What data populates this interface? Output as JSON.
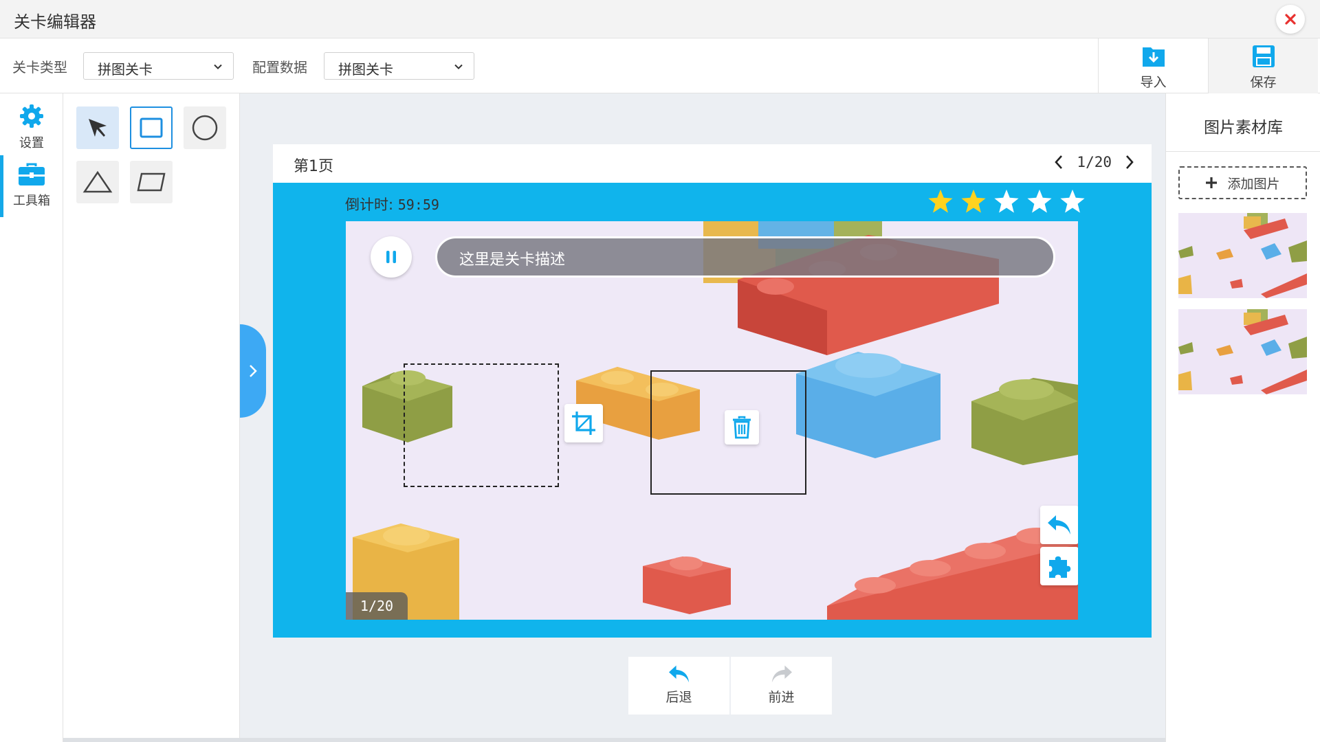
{
  "window": {
    "title": "关卡编辑器",
    "close_icon": "close-icon"
  },
  "toolbar": {
    "level_type_label": "关卡类型",
    "level_type_value": "拼图关卡",
    "config_label": "配置数据",
    "config_value": "拼图关卡",
    "import_label": "导入",
    "save_label": "保存"
  },
  "leftnav": {
    "settings_label": "设置",
    "toolbox_label": "工具箱"
  },
  "tools": [
    "select",
    "rectangle",
    "ellipse",
    "triangle",
    "parallelogram"
  ],
  "page": {
    "title": "第1页",
    "pager": "1/20",
    "countdown_label": "倒计时:",
    "countdown_value": "59:59",
    "stars_filled": 2,
    "stars_total": 5,
    "description": "这里是关卡描述",
    "counter": "1/20"
  },
  "history": {
    "undo_label": "后退",
    "redo_label": "前进"
  },
  "library": {
    "title": "图片素材库",
    "add_label": "添加图片",
    "thumbnails": 2
  },
  "colors": {
    "accent": "#10b4ec",
    "star_filled": "#ffd21f",
    "close": "#e8312f"
  }
}
